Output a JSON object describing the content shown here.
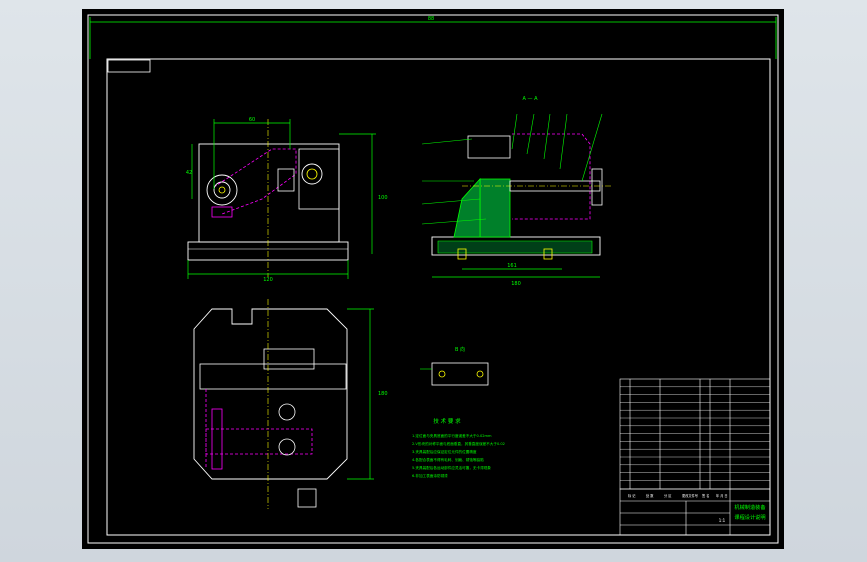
{
  "drawing": {
    "background_color": "#000000",
    "frame_color": "#ffffff",
    "line_colors": {
      "outline": "#ffffff",
      "dimension": "#00ff00",
      "hidden": "#ff00ff",
      "section": "#00ff00",
      "accent": "#ffff00",
      "leader": "#00ffff"
    },
    "view_labels": {
      "section": "A — A",
      "detail": "B 向"
    },
    "dimensions": {
      "top_overall": "88",
      "left_width": "60",
      "left_height": "42",
      "left_tall": "100",
      "left_bottom": "120",
      "right_inner": "161",
      "right_overall": "180",
      "plan_height": "180"
    },
    "notes": {
      "heading": "技 术 要 求",
      "items": [
        "1.定位面与夹具底面的平行度误差不大于0.02mm",
        "2.V形块的对称平面与底面垂直，其垂直度误差不大于0.02",
        "3.夹具装配后应保证定位元件的位置精度",
        "4.各配合表面不得有毛刺、划痕、锈蚀等缺陷",
        "5.夹具装配后各运动部件应灵活可靠，无卡滞现象",
        "6.非加工表面涂防锈漆"
      ]
    },
    "title_block": {
      "title_line1": "机械制造装备",
      "title_line2": "课程设计说明",
      "scale_label": "1:1",
      "footer_row": [
        "标 记",
        "处 数",
        "分 区",
        "更改文件号",
        "签 名",
        "年 月 日"
      ]
    }
  }
}
